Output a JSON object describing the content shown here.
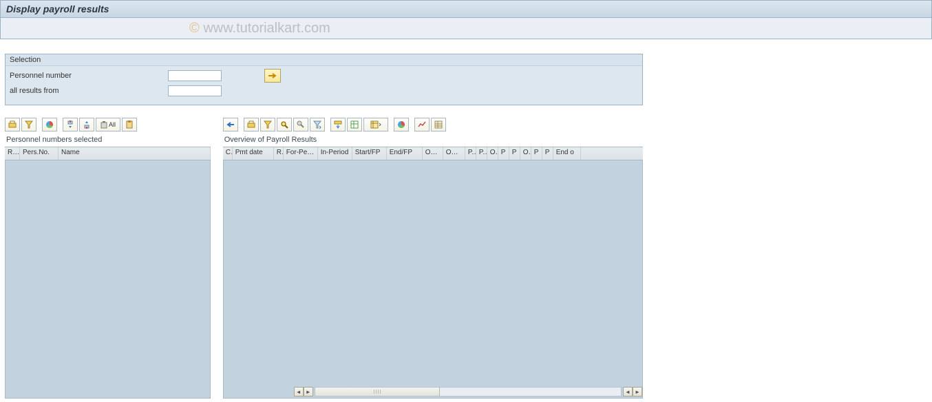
{
  "title": "Display payroll results",
  "watermark": "© www.tutorialkart.com",
  "selection": {
    "header": "Selection",
    "personnel_label": "Personnel number",
    "personnel_value": "",
    "allresults_label": "all results from",
    "allresults_value": ""
  },
  "left_panel": {
    "heading": "Personnel numbers selected",
    "columns": [
      "R...",
      "Pers.No.",
      "Name"
    ],
    "toolbar_icons": [
      "print-icon",
      "filter-icon",
      "chart-circle-icon",
      "expand-icon",
      "collapse-icon",
      "delete-all-icon",
      "clipboard-icon"
    ],
    "delete_all_label": "All"
  },
  "right_panel": {
    "heading": "Overview of Payroll Results",
    "columns": [
      "C",
      "Pmt date",
      "R",
      "For-Peri...",
      "In-Period",
      "Start/FP",
      "End/FP",
      "OC ...",
      "OC ...",
      "P...",
      "P...",
      "O",
      "P",
      "P",
      "O",
      "P",
      "P",
      "End o"
    ],
    "toolbar_icons": [
      "back-icon",
      "print-icon",
      "filter-icon",
      "find-icon",
      "find-next-icon",
      "filter-set-icon",
      "export-icon",
      "spreadsheet-icon",
      "layout-icon",
      "chart-circle-icon",
      "stats-icon",
      "grid-icon"
    ]
  }
}
